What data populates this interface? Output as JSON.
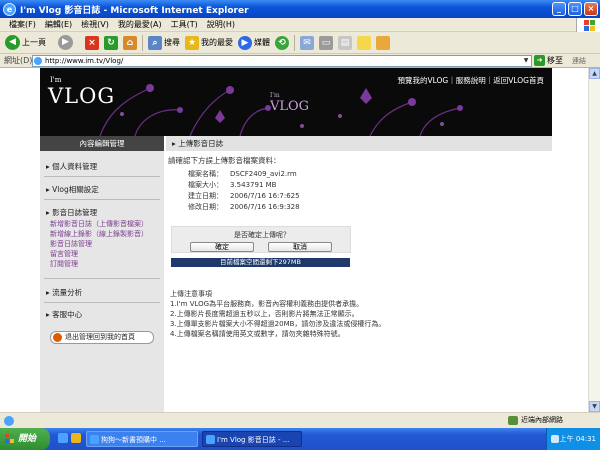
{
  "window": {
    "title": "I'm Vlog 影音日誌 - Microsoft Internet Explorer"
  },
  "menu": [
    "檔案(F)",
    "編輯(E)",
    "檢視(V)",
    "我的最愛(A)",
    "工具(T)",
    "說明(H)"
  ],
  "toolbar": {
    "back": "上一頁",
    "search": "搜尋",
    "favorites": "我的最愛",
    "media": "媒體"
  },
  "address": {
    "label": "網址(D)",
    "url": "http://www.im.tv/Vlog/",
    "go": "移至",
    "links": "連結"
  },
  "banner": {
    "logo_im": "I'm",
    "logo_vlog": "VLOG",
    "nav": "預覽我的VLOG｜服務說明｜返回VLOG首頁"
  },
  "sidebar": {
    "header": "內容編輯管理",
    "section_personal": "個人資料管理",
    "section_vlog": "Vlog相關設定",
    "section_media": "影音日誌管理",
    "media_links": [
      "新增影音日誌（上傳影音檔案）",
      "新增線上錄影（線上錄製影音）",
      "影音日誌管理",
      "留言管理",
      "訂閱管理"
    ],
    "section_traffic": "流量分析",
    "section_service": "客服中心",
    "back_button": "退出管理回到我的首頁"
  },
  "main": {
    "header": "上傳影音日誌",
    "intro": "請確認下方誤上傳影音檔案資料：",
    "file_info": [
      {
        "key": "檔案名稱：",
        "value": "DSCF2409_avi2.rm"
      },
      {
        "key": "檔案大小：",
        "value": "3.543791 MB"
      },
      {
        "key": "建立日期：",
        "value": "2006/7/16 16:7:625"
      },
      {
        "key": "修改日期：",
        "value": "2006/7/16 16:9:328"
      }
    ],
    "confirm_question": "是否確定上傳呢？",
    "confirm_ok": "確定",
    "confirm_cancel": "取消",
    "quota": "目前檔案空間還剩下297MB",
    "notes_title": "上傳注意事項",
    "notes": [
      "1.I'm VLOG為平台服務商，影音內容權利義務由提供者承擔。",
      "2.上傳影片長度需超過五秒以上，否則影片將無法正常顯示。",
      "3.上傳單支影片檔案大小不得超過20MB，請勿涉及違法或侵權行為。",
      "4.上傳檔案名稱請使用英文或數字，請勿夾雜特殊符號。"
    ]
  },
  "status": {
    "zone": "近端內部網路"
  },
  "taskbar": {
    "start": "開始",
    "tasks": [
      "狗狗～新書預購中 ...",
      "I'm Vlog 影音日誌 - ..."
    ],
    "clock": "上午 04:31"
  },
  "colors": {
    "titlebar": "#0a54d8",
    "sidebar_link": "#7a3d8e",
    "quota_bar": "#1f3a6a",
    "banner_bg": "#0a0a0a"
  }
}
